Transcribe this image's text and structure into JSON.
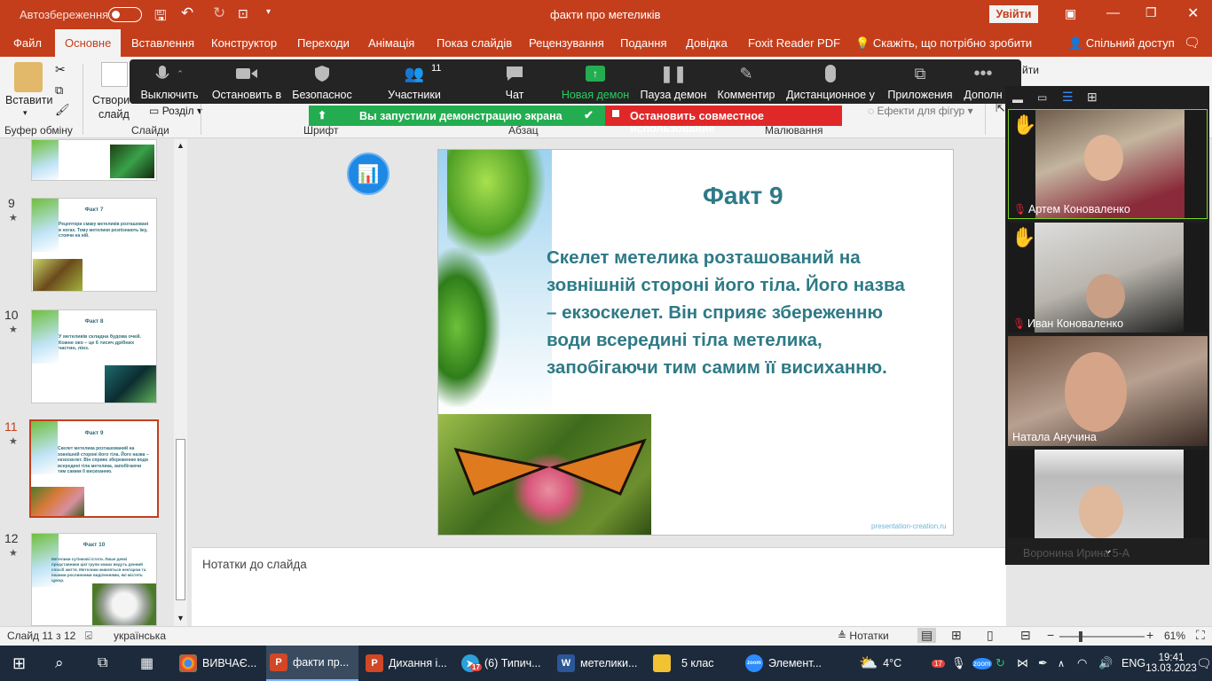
{
  "titlebar": {
    "autosave_label": "Автозбереження",
    "autosave_state": "Вимк.",
    "doc_title": "факти про метеликів",
    "signin_button": "Увійти"
  },
  "tabs": [
    "Файл",
    "Основне",
    "Вставлення",
    "Конструктор",
    "Переходи",
    "Анімація",
    "Показ слайдів",
    "Рецензування",
    "Подання",
    "Довідка",
    "Foxit Reader PDF"
  ],
  "tell_me": "Скажіть, що потрібно зробити",
  "share": "Спільний доступ",
  "ribbon": {
    "paste_label": "Вставити",
    "new_slide_label_1": "Створити",
    "new_slide_label_2": "слайд",
    "section_label": "Розділ",
    "shape_effects": "Ефекти для фігур",
    "groups": {
      "clipboard": "Буфер обміну",
      "slides": "Слайди",
      "font": "Шрифт",
      "paragraph": "Абзац",
      "drawing": "Малювання"
    },
    "right_partial": "йти"
  },
  "zoom_toolbar": {
    "participants_count": "11",
    "items": [
      {
        "label": "Выключить",
        "icon": "microphone-icon"
      },
      {
        "label": "Остановить в",
        "icon": "video-camera-icon"
      },
      {
        "label": "Безопаснос",
        "icon": "shield-icon"
      },
      {
        "label": "Участники",
        "icon": "participants-icon"
      },
      {
        "label": "Чат",
        "icon": "chat-icon"
      },
      {
        "label": "Новая демон",
        "icon": "share-screen-icon"
      },
      {
        "label": "Пауза демон",
        "icon": "pause-icon"
      },
      {
        "label": "Комментир",
        "icon": "pen-icon"
      },
      {
        "label": "Дистанционное у",
        "icon": "mouse-icon"
      },
      {
        "label": "Приложения",
        "icon": "apps-icon"
      },
      {
        "label": "Дополн",
        "icon": "more-icon"
      }
    ],
    "share_notice": "Вы запустили демонстрацию экрана",
    "stop_share": "Остановить совместное использование"
  },
  "thumbnails": [
    {
      "num": "9",
      "title": "Факт 7",
      "text": "Рецептори смаку метеликів розташовані в ногах. Тому метелики розпізнають їжу, стоячи на ній."
    },
    {
      "num": "10",
      "title": "Факт 8",
      "text": "У метеликів складна будова очей. Кожне око – це 6 тисяч дрібних частин, лінз."
    },
    {
      "num": "11",
      "title": "Факт 9",
      "text": "Скелет метелика розташований на зовнішній стороні його тіла. Його назва – екзоскелет. Він сприяє збереженню води всередині тіла метелика, запобігаючи тим самим її висиханню."
    },
    {
      "num": "12",
      "title": "Факт 10",
      "text": "Метелики сутінкові істоти. Лише деякі представники цієї групи комах ведуть денний спосіб життя. Метелики живляться нектаром та іншими рослинними виділеннями, які містять цукор."
    }
  ],
  "slide": {
    "title": "Факт 9",
    "body": "Скелет метелика розташований на зовнішній стороні його тіла. Його назва – екзоскелет. Він сприяє збереженню води всередині тіла метелика, запобігаючи тим самим її висиханню.",
    "watermark": "presentation-creation.ru"
  },
  "notes_placeholder": "Нотатки до слайда",
  "gallery": [
    {
      "name": "Артем Коноваленко",
      "raised_hand": true,
      "muted": true
    },
    {
      "name": "Иван Коноваленко",
      "raised_hand": true,
      "muted": true
    },
    {
      "name": "Натала Анучина",
      "raised_hand": false,
      "muted": false
    },
    {
      "name": "Воронина Ирина 5-А",
      "raised_hand": false,
      "muted": false
    }
  ],
  "status": {
    "slide_counter": "Слайд 11 з 12",
    "language": "українська",
    "notes_button": "Нотатки",
    "zoom_level": "61%"
  },
  "taskbar": {
    "apps": [
      {
        "label": "ВИВЧАЄ...",
        "icon": "chrome-icon"
      },
      {
        "label": "факти пр...",
        "icon": "powerpoint-icon"
      },
      {
        "label": "Дихання і...",
        "icon": "powerpoint-icon"
      },
      {
        "label": "(6) Типич...",
        "icon": "telegram-icon",
        "badge": "17"
      },
      {
        "label": "метелики...",
        "icon": "word-icon"
      },
      {
        "label": "5 клас",
        "icon": "folder-icon"
      },
      {
        "label": "Элемент...",
        "icon": "zoom-icon"
      }
    ],
    "weather": "4°C",
    "tray_badge": "17",
    "lang": "ENG",
    "time": "19:41",
    "date": "13.03.2023"
  },
  "colors": {
    "accent": "#c43e1c",
    "slide_text": "#2e7a86",
    "zoom_green": "#23ad50",
    "zoom_red": "#e02828"
  }
}
